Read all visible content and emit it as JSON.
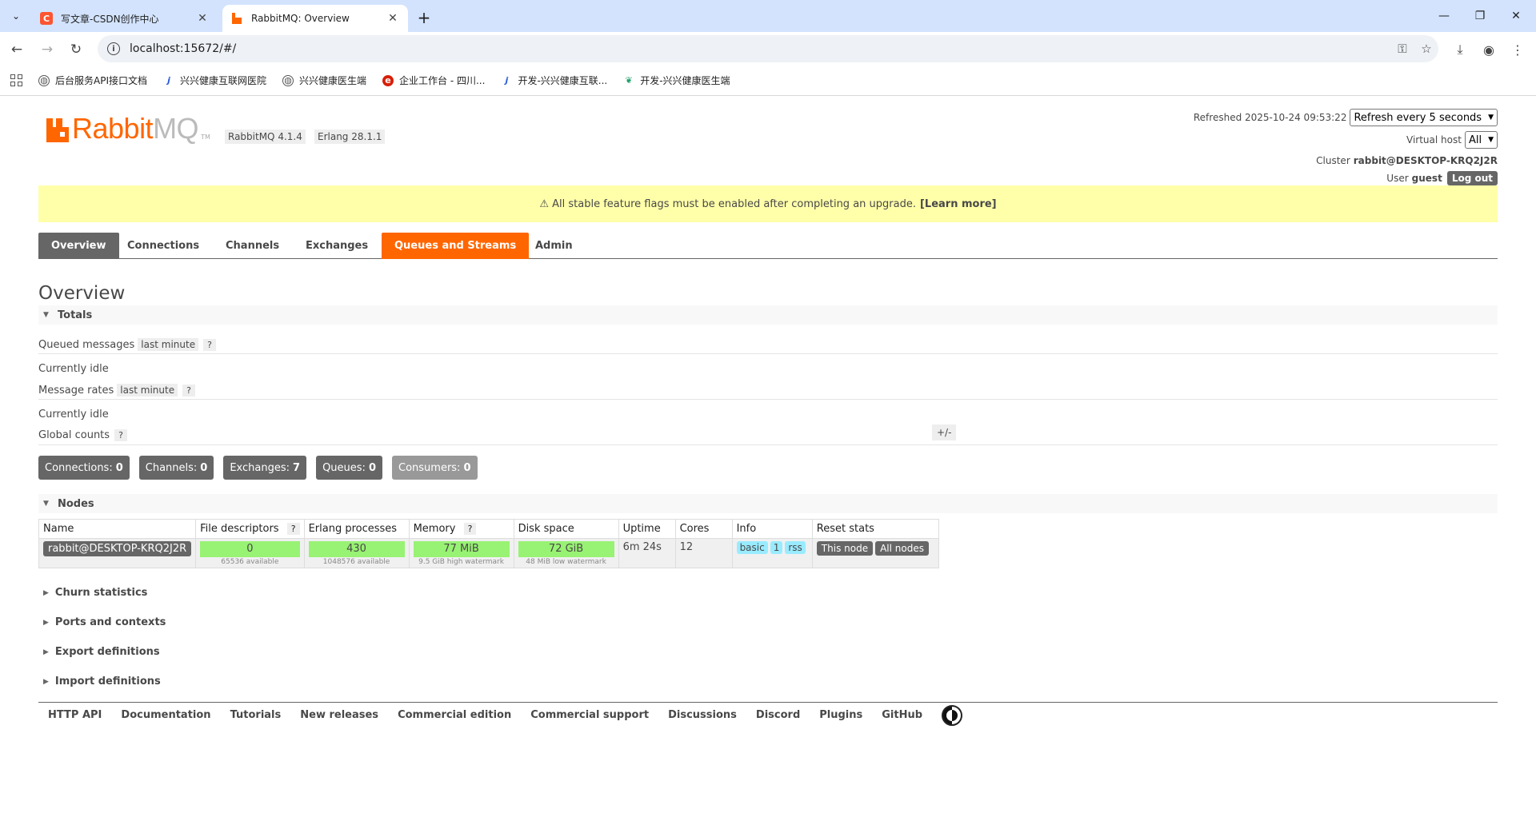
{
  "browser": {
    "tabs": [
      {
        "title": "写文章-CSDN创作中心",
        "favicon": "csdn-icon"
      },
      {
        "title": "RabbitMQ: Overview",
        "favicon": "rabbitmq-icon"
      }
    ],
    "url": "localhost:15672/#/",
    "bookmarks": [
      {
        "label": "后台服务API接口文档",
        "icon": "globe-icon"
      },
      {
        "label": "兴兴健康互联网医院",
        "icon": "j-icon"
      },
      {
        "label": "兴兴健康医生端",
        "icon": "globe-icon"
      },
      {
        "label": "企业工作台 - 四川...",
        "icon": "red-circle-icon"
      },
      {
        "label": "开发-兴兴健康互联...",
        "icon": "j-icon"
      },
      {
        "label": "开发-兴兴健康医生端",
        "icon": "leaf-icon"
      }
    ]
  },
  "header": {
    "logo_word1": "Rabbit",
    "logo_word2": "MQ",
    "logo_tm": "TM",
    "rabbitmq_version": "RabbitMQ 4.1.4",
    "erlang_version": "Erlang 28.1.1",
    "refreshed_label": "Refreshed 2025-10-24 09:53:22",
    "refresh_select": "Refresh every 5 seconds",
    "vhost_label": "Virtual host",
    "vhost_select": "All",
    "cluster_label": "Cluster",
    "cluster_name": "rabbit@DESKTOP-KRQ2J2R",
    "user_label": "User",
    "user_name": "guest",
    "logout": "Log out"
  },
  "warning": {
    "text": "⚠ All stable feature flags must be enabled after completing an upgrade.",
    "link": "[Learn more]"
  },
  "nav": [
    "Overview",
    "Connections",
    "Channels",
    "Exchanges",
    "Queues and Streams",
    "Admin"
  ],
  "overview": {
    "title": "Overview",
    "totals_header": "Totals",
    "queued_label": "Queued messages",
    "queued_chip": "last minute",
    "help": "?",
    "idle1": "Currently idle",
    "rates_label": "Message rates",
    "rates_chip": "last minute",
    "idle2": "Currently idle",
    "global_label": "Global counts",
    "counts": [
      {
        "label": "Connections:",
        "value": "0"
      },
      {
        "label": "Channels:",
        "value": "0"
      },
      {
        "label": "Exchanges:",
        "value": "7"
      },
      {
        "label": "Queues:",
        "value": "0"
      },
      {
        "label": "Consumers:",
        "value": "0"
      }
    ]
  },
  "nodes": {
    "header": "Nodes",
    "columns": [
      "Name",
      "File descriptors",
      "Erlang processes",
      "Memory",
      "Disk space",
      "Uptime",
      "Cores",
      "Info",
      "Reset stats"
    ],
    "plusminus": "+/-",
    "row": {
      "name": "rabbit@DESKTOP-KRQ2J2R",
      "fd": "0",
      "fd_sub": "65536 available",
      "proc": "430",
      "proc_sub": "1048576 available",
      "mem": "77 MiB",
      "mem_sub": "9.5 GiB high watermark",
      "disk": "72 GiB",
      "disk_sub": "48 MiB low watermark",
      "uptime": "6m 24s",
      "cores": "12",
      "info": [
        "basic",
        "1",
        "rss"
      ],
      "reset_this": "This node",
      "reset_all": "All nodes"
    }
  },
  "collapsed_sections": [
    "Churn statistics",
    "Ports and contexts",
    "Export definitions",
    "Import definitions"
  ],
  "footer": [
    "HTTP API",
    "Documentation",
    "Tutorials",
    "New releases",
    "Commercial edition",
    "Commercial support",
    "Discussions",
    "Discord",
    "Plugins",
    "GitHub"
  ]
}
